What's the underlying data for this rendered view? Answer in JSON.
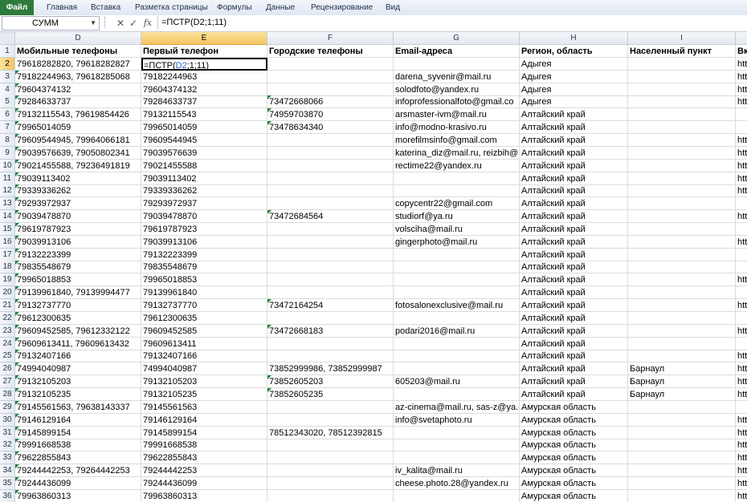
{
  "ribbon": {
    "tabs": [
      "Файл",
      "Главная",
      "Вставка",
      "Разметка страницы",
      "Формулы",
      "Данные",
      "Рецензирование",
      "Вид"
    ]
  },
  "formula_bar": {
    "name_box": "СУММ",
    "cancel_symbol": "✕",
    "enter_symbol": "✓",
    "fx_symbol": "fx",
    "formula": "=ПСТР(D2;1;11)"
  },
  "active_cell": {
    "prefix": "=ПСТР(",
    "ref": "D2",
    "suffix": ";1;11)"
  },
  "columns": [
    "D",
    "E",
    "F",
    "G",
    "H",
    "I",
    ""
  ],
  "row_numbers": [
    "1",
    "2",
    "3",
    "4",
    "5",
    "6",
    "7",
    "8",
    "9",
    "10",
    "11",
    "12",
    "13",
    "14",
    "15",
    "16",
    "17",
    "18",
    "19",
    "20",
    "21",
    "22",
    "23",
    "24",
    "25",
    "26",
    "27",
    "28",
    "29",
    "30",
    "31",
    "32",
    "33",
    "34",
    "35",
    "36"
  ],
  "header_row": [
    "Мобильные телефоны",
    "Первый телефон",
    "Городские телефоны",
    "Email-адреса",
    "Регион, область",
    "Населенный пункт",
    "Вк"
  ],
  "rows": [
    [
      "79618282820, 79618282827",
      "",
      "",
      "",
      "Адыгея",
      "",
      "htt"
    ],
    [
      "79182244963, 79618285068",
      "79182244963",
      "",
      "darena_syvenir@mail.ru",
      "Адыгея",
      "",
      "htt"
    ],
    [
      "79604374132",
      "79604374132",
      "",
      "solodfoto@yandex.ru",
      "Адыгея",
      "",
      "htt"
    ],
    [
      "79284633737",
      "79284633737",
      "73472668066",
      "infoprofessionalfoto@gmail.co",
      "Адыгея",
      "",
      "htt"
    ],
    [
      "79132115543, 79619854426",
      "79132115543",
      "74959703870",
      "arsmaster-ivm@mail.ru",
      "Алтайский край",
      "",
      ""
    ],
    [
      "79965014059",
      "79965014059",
      "73478634340",
      "info@modno-krasivo.ru",
      "Алтайский край",
      "",
      ""
    ],
    [
      "79609544945, 79964066181",
      "79609544945",
      "",
      "morefilmsinfo@gmail.com",
      "Алтайский край",
      "",
      "htt"
    ],
    [
      "79039576639, 79050802341",
      "79039576639",
      "",
      "katerina_diz@mail.ru, reizbih@",
      "Алтайский край",
      "",
      "htt"
    ],
    [
      "79021455588, 79236491819",
      "79021455588",
      "",
      "rectime22@yandex.ru",
      "Алтайский край",
      "",
      "htt"
    ],
    [
      "79039113402",
      "79039113402",
      "",
      "",
      "Алтайский край",
      "",
      "htt"
    ],
    [
      "79339336262",
      "79339336262",
      "",
      "",
      "Алтайский край",
      "",
      "htt"
    ],
    [
      "79293972937",
      "79293972937",
      "",
      "copycentr22@gmail.com",
      "Алтайский край",
      "",
      ""
    ],
    [
      "79039478870",
      "79039478870",
      "73472684564",
      "studiorf@ya.ru",
      "Алтайский край",
      "",
      "htt"
    ],
    [
      "79619787923",
      "79619787923",
      "",
      "volsciha@mail.ru",
      "Алтайский край",
      "",
      ""
    ],
    [
      "79039913106",
      "79039913106",
      "",
      "gingerphoto@mail.ru",
      "Алтайский край",
      "",
      "htt"
    ],
    [
      "79132223399",
      "79132223399",
      "",
      "",
      "Алтайский край",
      "",
      ""
    ],
    [
      "79835548679",
      "79835548679",
      "",
      "",
      "Алтайский край",
      "",
      ""
    ],
    [
      "79965018853",
      "79965018853",
      "",
      "",
      "Алтайский край",
      "",
      "htt"
    ],
    [
      "79139961840, 79139994477",
      "79139961840",
      "",
      "",
      "Алтайский край",
      "",
      ""
    ],
    [
      "79132737770",
      "79132737770",
      "73472164254",
      "fotosalonexclusive@mail.ru",
      "Алтайский край",
      "",
      "htt"
    ],
    [
      "79612300635",
      "79612300635",
      "",
      "",
      "Алтайский край",
      "",
      ""
    ],
    [
      "79609452585, 79612332122",
      "79609452585",
      "73472668183",
      "podari2016@mail.ru",
      "Алтайский край",
      "",
      "htt"
    ],
    [
      "79609613411, 79609613432",
      "79609613411",
      "",
      "",
      "Алтайский край",
      "",
      ""
    ],
    [
      "79132407166",
      "79132407166",
      "",
      "",
      "Алтайский край",
      "",
      "htt"
    ],
    [
      "74994040987",
      "74994040987",
      "73852999986, 73852999987",
      "",
      "Алтайский край",
      "Барнаул",
      "htt"
    ],
    [
      "79132105203",
      "79132105203",
      "73852605203",
      "605203@mail.ru",
      "Алтайский край",
      "Барнаул",
      "htt"
    ],
    [
      "79132105235",
      "79132105235",
      "73852605235",
      "",
      "Алтайский край",
      "Барнаул",
      "htt"
    ],
    [
      "79145561563, 79638143337",
      "79145561563",
      "",
      "az-cinema@mail.ru, sas-z@ya.ru",
      "Амурская область",
      "",
      ""
    ],
    [
      "79146129164",
      "79146129164",
      "",
      "info@svetaphoto.ru",
      "Амурская область",
      "",
      "htt"
    ],
    [
      "79145899154",
      "79145899154",
      "78512343020, 78512392815",
      "",
      "Амурская область",
      "",
      "htt"
    ],
    [
      "79991668538",
      "79991668538",
      "",
      "",
      "Амурская область",
      "",
      "htt"
    ],
    [
      "79622855843",
      "79622855843",
      "",
      "",
      "Амурская область",
      "",
      "htt"
    ],
    [
      "79244442253, 79264442253",
      "79244442253",
      "",
      "iv_kalita@mail.ru",
      "Амурская область",
      "",
      "htt"
    ],
    [
      "79244436099",
      "79244436099",
      "",
      "cheese.photo.28@yandex.ru",
      "Амурская область",
      "",
      "htt"
    ],
    [
      "79963860313",
      "79963860313",
      "",
      "",
      "Амурская область",
      "",
      "htt"
    ]
  ],
  "green_triangle_cells": {
    "D": [
      3,
      4,
      5,
      6,
      7,
      8,
      9,
      10,
      11,
      12,
      13,
      14,
      15,
      16,
      17,
      18,
      19,
      20,
      21,
      22,
      23,
      24,
      25,
      26,
      27,
      28,
      29,
      30,
      31,
      32,
      33,
      34,
      35,
      36
    ],
    "F": [
      5,
      6,
      7,
      14,
      21,
      23,
      27,
      28
    ]
  }
}
